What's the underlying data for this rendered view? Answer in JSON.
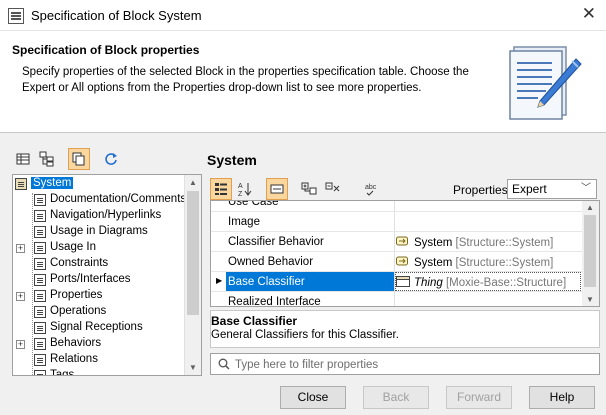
{
  "window": {
    "title": "Specification of Block System",
    "close_glyph": "✕"
  },
  "header": {
    "title": "Specification of Block properties",
    "description": "Specify properties of the selected Block in the properties specification table. Choose the Expert or All options from the Properties drop-down list to see more properties."
  },
  "left_toolbar": {
    "buttons": [
      "tree-table-icon",
      "hierarchy-icon",
      "copy-view-icon",
      "refresh-icon"
    ]
  },
  "tree": {
    "items": [
      {
        "label": "System",
        "selected": true
      },
      {
        "label": "Documentation/Comments"
      },
      {
        "label": "Navigation/Hyperlinks"
      },
      {
        "label": "Usage in Diagrams"
      },
      {
        "label": "Usage In",
        "expandable": true
      },
      {
        "label": "Constraints"
      },
      {
        "label": "Ports/Interfaces"
      },
      {
        "label": "Properties",
        "expandable": true
      },
      {
        "label": "Operations"
      },
      {
        "label": "Signal Receptions"
      },
      {
        "label": "Behaviors",
        "expandable": true
      },
      {
        "label": "Relations"
      },
      {
        "label": "Tags"
      }
    ]
  },
  "right": {
    "title": "System",
    "properties_label": "Properties:",
    "properties_value": "Expert",
    "toolbar_buttons": [
      "categorized-icon",
      "sort-az-icon",
      "description-toggle-icon",
      "expand-all-icon",
      "collapse-all-icon",
      "abc-spelling-icon"
    ]
  },
  "grid": {
    "rows": [
      {
        "name": "Use Case",
        "value": "",
        "value_extra": ""
      },
      {
        "name": "Image",
        "value": "",
        "value_extra": ""
      },
      {
        "name": "Classifier Behavior",
        "value": "System",
        "value_extra": "[Structure::System]",
        "icon": "behavior-icon"
      },
      {
        "name": "Owned Behavior",
        "value": "System",
        "value_extra": "[Structure::System]",
        "icon": "behavior-icon"
      },
      {
        "name": "Base Classifier",
        "value": "Thing",
        "value_extra": "[Moxie-Base::Structure]",
        "icon": "block-icon",
        "selected": true
      },
      {
        "name": "Realized Interface",
        "value": "",
        "value_extra": ""
      }
    ]
  },
  "description": {
    "title": "Base Classifier",
    "text": "General Classifiers for this Classifier."
  },
  "filter": {
    "placeholder": "Type here to filter properties"
  },
  "buttons": {
    "close": "Close",
    "back": "Back",
    "forward": "Forward",
    "help": "Help"
  },
  "colors": {
    "selection": "#0078d7",
    "active_tool": "#fbd7a0"
  }
}
